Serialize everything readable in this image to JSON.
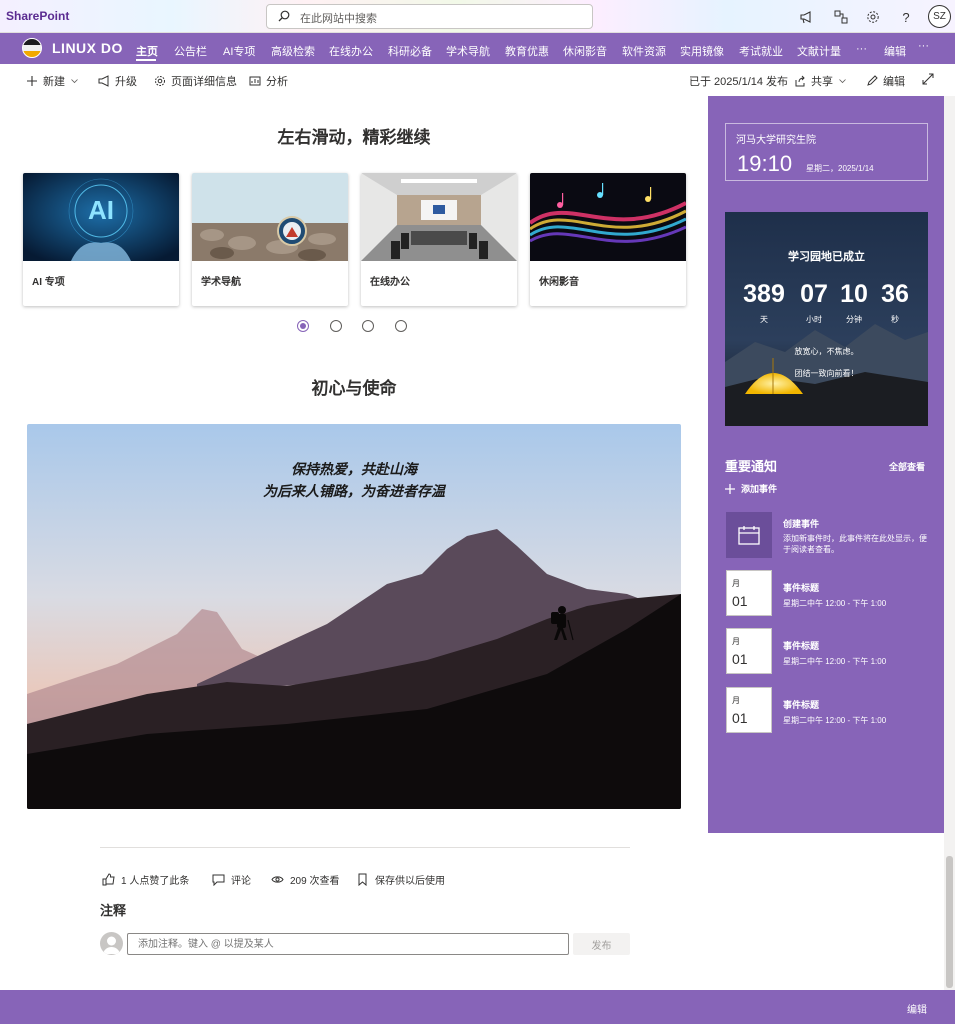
{
  "suite": {
    "brand": "SharePoint",
    "search_placeholder": "在此网站中搜索",
    "icons": [
      "megaphone-icon",
      "share-network-icon",
      "settings-icon",
      "help-icon"
    ],
    "avatar_initials": "SZ"
  },
  "nav": {
    "site_title": "LINUX DO",
    "items": [
      "主页",
      "公告栏",
      "AI专项",
      "高级检索",
      "在线办公",
      "科研必备",
      "学术导航",
      "教育优惠",
      "休闲影音",
      "软件资源",
      "实用镜像",
      "考试就业",
      "文献计量",
      "···"
    ],
    "edit": "编辑",
    "more": "···"
  },
  "command_bar": {
    "new": "新建",
    "upgrade": "升级",
    "page_details": "页面详细信息",
    "analytics": "分析",
    "published": "已于 2025/1/14 发布",
    "share": "共享",
    "edit": "编辑"
  },
  "carousel": {
    "title": "左右滑动，精彩继续",
    "cards": [
      {
        "label": "AI 专项"
      },
      {
        "label": "学术导航"
      },
      {
        "label": "在线办公"
      },
      {
        "label": "休闲影音"
      }
    ],
    "page_count": 4,
    "active_page": 1
  },
  "mission": {
    "title": "初心与使命",
    "line1": "保持热爱，共赴山海",
    "line2": "为后来人铺路，为奋进者存温"
  },
  "sidebar": {
    "clock": {
      "org": "河马大学研究生院",
      "time": "19:10",
      "date": "星期二，2025/1/14"
    },
    "countdown": {
      "title": "学习园地已成立",
      "days": "389",
      "hours": "07",
      "minutes": "10",
      "seconds": "36",
      "unit_days": "天",
      "unit_hours": "小时",
      "unit_minutes": "分钟",
      "unit_seconds": "秒",
      "msg1": "放宽心，不焦虑。",
      "msg2": "团结一致向前看！"
    },
    "notices": {
      "title": "重要通知",
      "view_all": "全部查看",
      "add_event": "添加事件",
      "create_title": "创建事件",
      "create_desc": "添加新事件时，此事件将在此处显示，便于阅读者查看。",
      "events": [
        {
          "month": "月",
          "day": "01",
          "title": "事件标题",
          "time": "星期二中午 12:00 - 下午 1:00"
        },
        {
          "month": "月",
          "day": "01",
          "title": "事件标题",
          "time": "星期二中午 12:00 - 下午 1:00"
        },
        {
          "month": "月",
          "day": "01",
          "title": "事件标题",
          "time": "星期二中午 12:00 - 下午 1:00"
        }
      ]
    }
  },
  "social": {
    "likes": "1 人点赞了此条",
    "comment": "评论",
    "views": "209 次查看",
    "save": "保存供以后使用"
  },
  "comments": {
    "heading": "注释",
    "placeholder": "添加注释。键入 @ 以提及某人",
    "post": "发布"
  },
  "footer": {
    "edit": "编辑"
  },
  "colors": {
    "theme_purple": "#8764b8",
    "dark_purple": "#6b4e9a",
    "brand": "#5b2c91"
  }
}
